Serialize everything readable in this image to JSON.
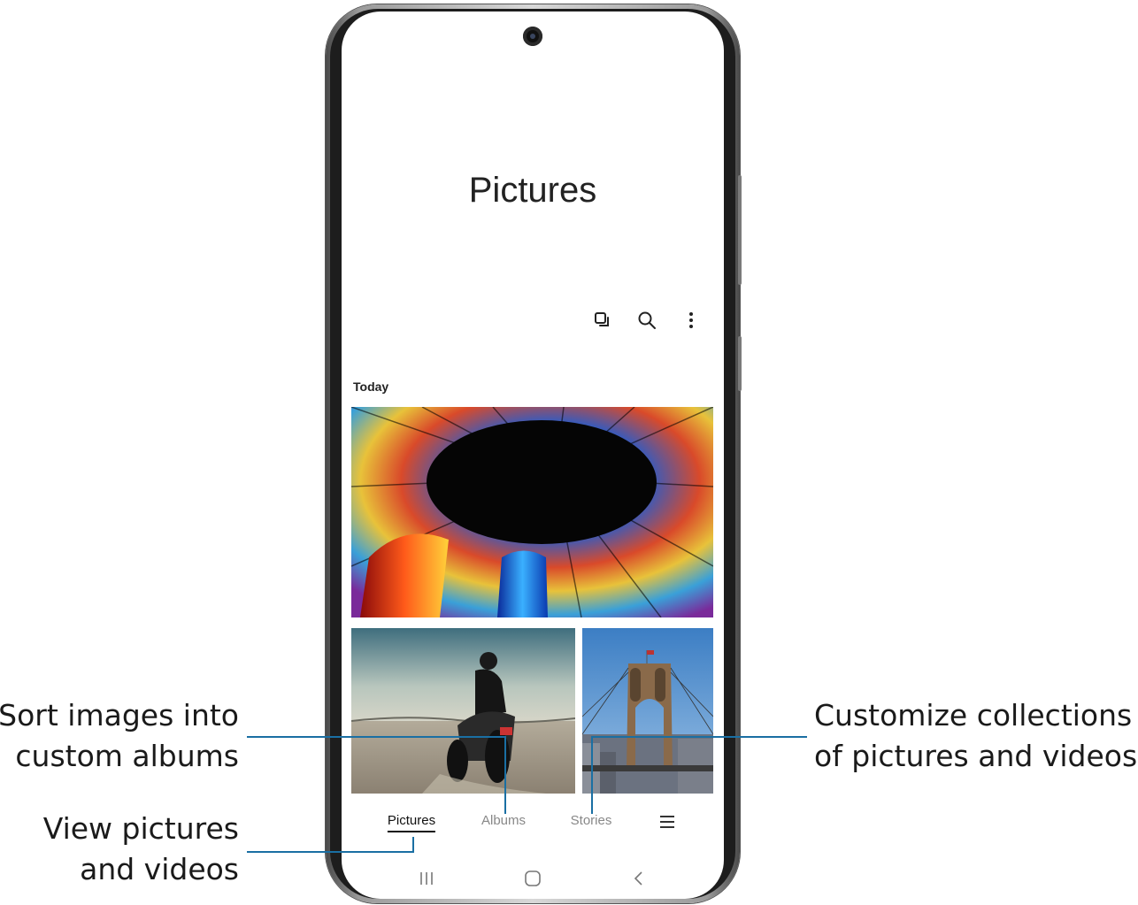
{
  "app": {
    "title": "Pictures"
  },
  "toolbar": {
    "icons": [
      "select-copy-icon",
      "search-icon",
      "more-options-icon"
    ]
  },
  "gallery": {
    "section_label": "Today",
    "photos": [
      {
        "subject": "stained-glass dome"
      },
      {
        "subject": "motorcyclist in desert"
      },
      {
        "subject": "suspension bridge"
      }
    ]
  },
  "tabs": [
    {
      "label": "Pictures",
      "active": true
    },
    {
      "label": "Albums",
      "active": false
    },
    {
      "label": "Stories",
      "active": false
    }
  ],
  "menu_icon": "hamburger-menu-icon",
  "navbar": {
    "icons": [
      "recent-apps-icon",
      "home-icon",
      "back-icon"
    ]
  },
  "callouts": {
    "albums": [
      "Sort images into",
      "custom albums"
    ],
    "pictures": [
      "View pictures",
      "and videos"
    ],
    "stories": [
      "Customize collections",
      "of pictures and videos"
    ]
  },
  "colors": {
    "leader_line": "#1a6fa3",
    "active_tab": "#111111",
    "inactive_tab": "#888888"
  }
}
